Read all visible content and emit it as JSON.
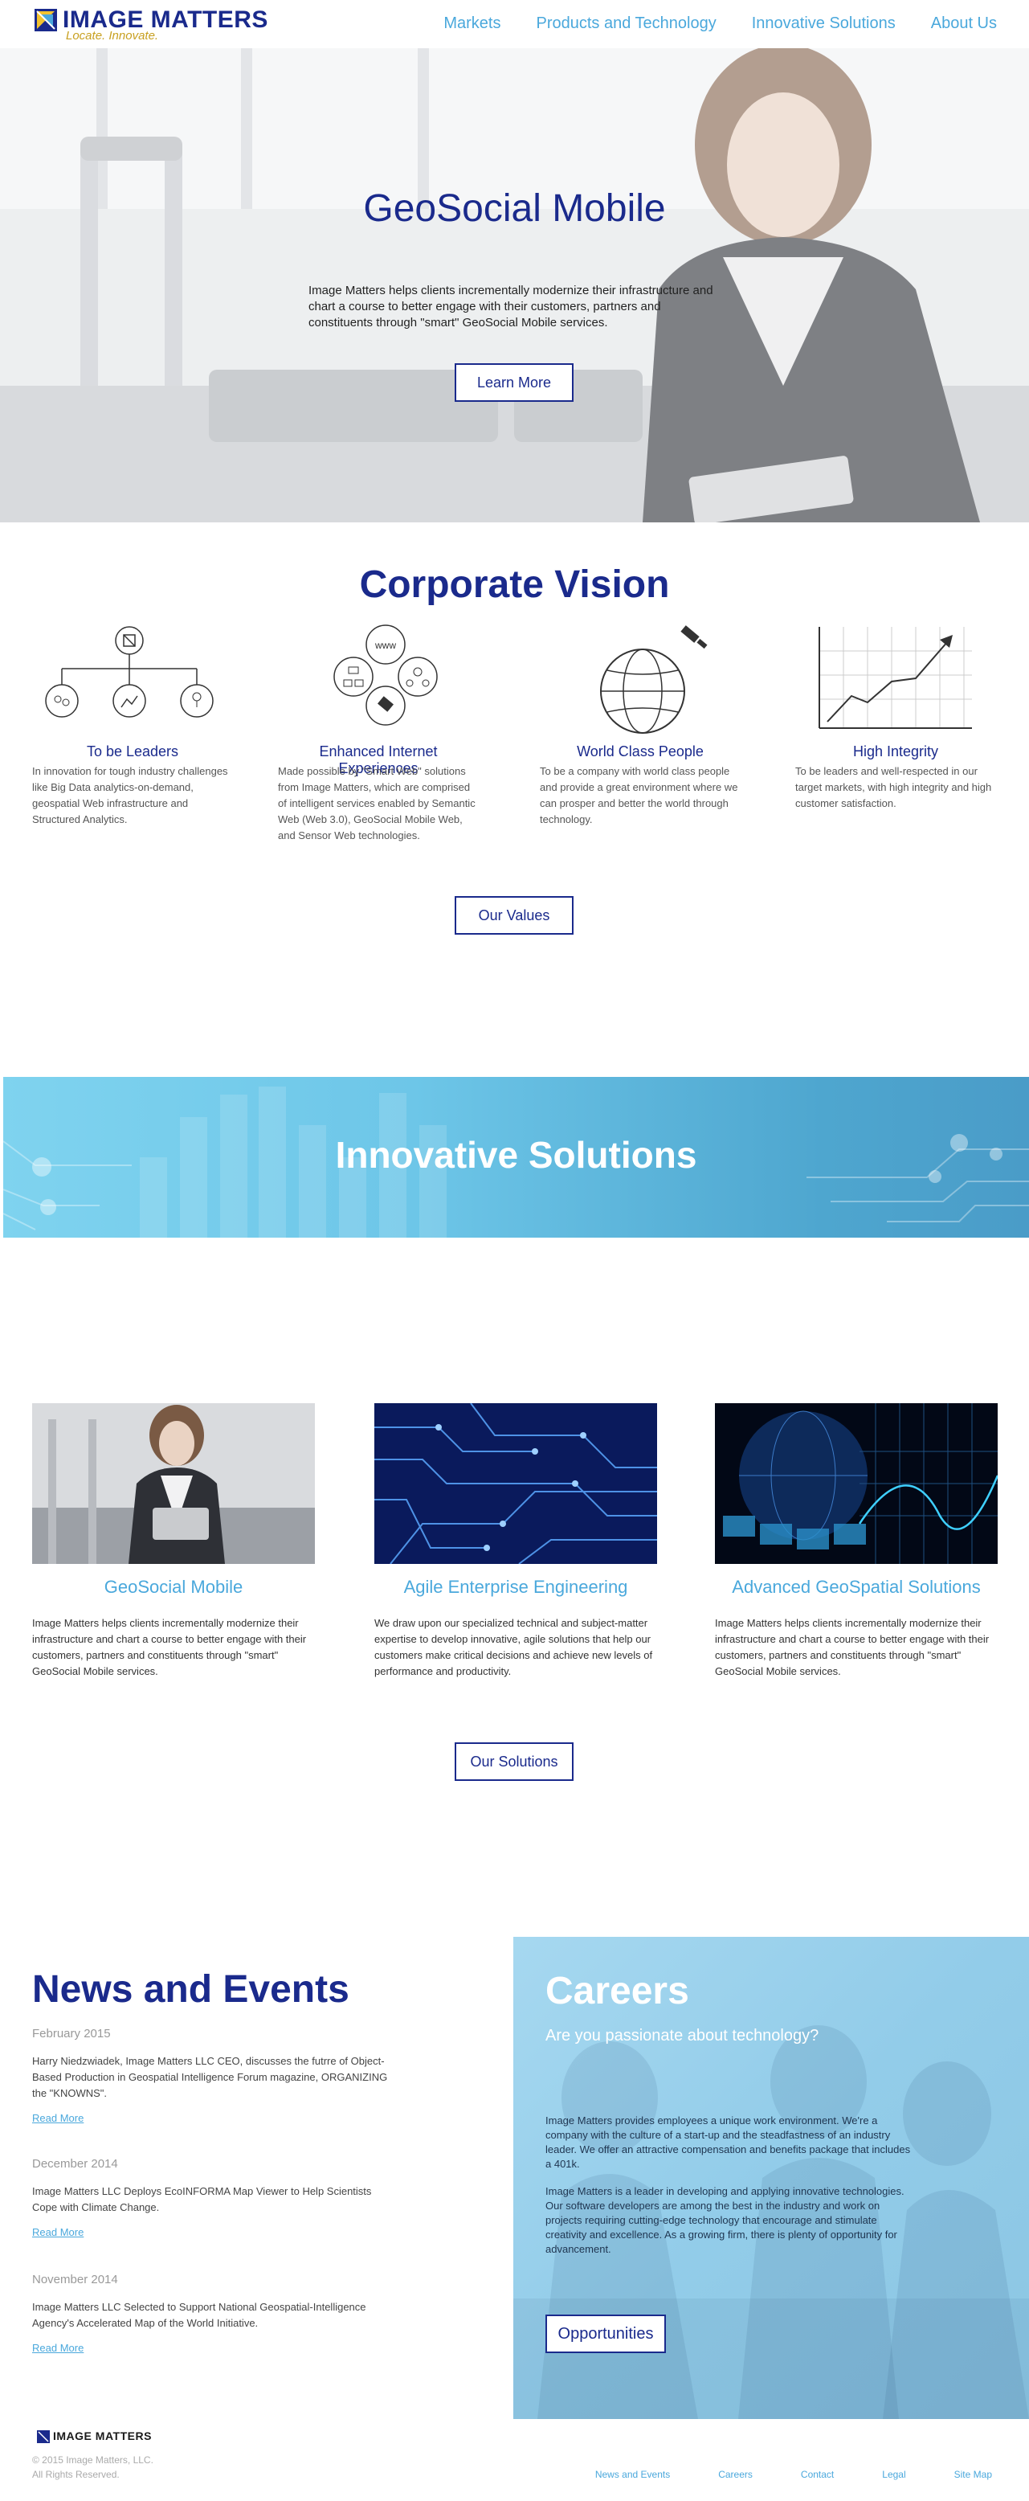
{
  "header": {
    "logo_name": "IMAGE MATTERS",
    "logo_tagline": "Locate.  Innovate.",
    "nav": [
      "Markets",
      "Products and Technology",
      "Innovative Solutions",
      "About Us"
    ]
  },
  "hero": {
    "title": "GeoSocial Mobile",
    "text": "Image Matters helps clients incrementally modernize their infrastructure and chart a course to better engage with their customers, partners and constituents through \"smart\" GeoSocial Mobile services.",
    "button": "Learn More"
  },
  "vision": {
    "title": "Corporate Vision",
    "items": [
      {
        "heading": "To be Leaders",
        "text": "In innovation for tough industry challenges like Big Data analytics-on-demand, geospatial Web infrastructure and Structured Analytics.",
        "icon": "hierarchy-icon"
      },
      {
        "heading": "Enhanced Internet Experiences",
        "text": "Made possible by \"Smart Web\" solutions from Image Matters, which are comprised of intelligent services enabled by Semantic Web (Web 3.0), GeoSocial Mobile Web, and Sensor Web technologies.",
        "icon": "web-network-icon",
        "icon_label": "www"
      },
      {
        "heading": "World Class People",
        "text": "To be a company with world class people and provide a great environment where we can prosper and better the world through technology.",
        "icon": "globe-satellite-icon"
      },
      {
        "heading": "High Integrity",
        "text": "To be leaders and well-respected in our target markets, with high integrity and high customer satisfaction.",
        "icon": "rising-chart-icon"
      }
    ],
    "button": "Our Values"
  },
  "band": {
    "title": "Innovative Solutions"
  },
  "solutions": {
    "items": [
      {
        "title": "GeoSocial Mobile",
        "text": "Image Matters helps clients incrementally modernize their infrastructure and chart a course to better engage with their customers, partners and constituents through \"smart\" GeoSocial Mobile services."
      },
      {
        "title": "Agile Enterprise Engineering",
        "text": "We draw upon our specialized technical and subject-matter expertise to develop innovative, agile solutions that help our customers make critical decisions and achieve new levels of performance and productivity."
      },
      {
        "title": "Advanced GeoSpatial Solutions",
        "text": "Image Matters helps clients incrementally modernize their infrastructure and chart a course to better engage with their customers, partners and constituents through \"smart\" GeoSocial Mobile services."
      }
    ],
    "button": "Our Solutions"
  },
  "news": {
    "title": "News and Events",
    "items": [
      {
        "date": "February 2015",
        "body": "Harry Niedzwiadek, Image Matters LLC CEO, discusses the futrre of Object-Based Production in Geospatial Intelligence Forum magazine, ORGANIZING the \"KNOWNS\".",
        "link": "Read More"
      },
      {
        "date": "December 2014",
        "body": "Image Matters LLC Deploys EcoINFORMA Map Viewer to Help Scientists Cope with Climate Change.",
        "link": "Read More"
      },
      {
        "date": "November 2014",
        "body": "Image Matters LLC Selected to Support National Geospatial-Intelligence Agency's Accelerated Map of the World Initiative.",
        "link": "Read More"
      }
    ]
  },
  "careers": {
    "title": "Careers",
    "subtitle": "Are you passionate about technology?",
    "p1": "Image Matters provides employees a unique work environment. We're a company with the culture of a start-up and the steadfastness of an industry leader. We offer an attractive compensation and benefits package that includes a 401k.",
    "p2": "Image Matters is a leader in developing and applying innovative technologies. Our software developers are among the best in the industry and work on projects requiring cutting-edge technology that encourage and stimulate creativity and excellence. As a growing firm, there is plenty of opportunity for advancement.",
    "button": "Opportunities"
  },
  "footer": {
    "logo_name": "IMAGE MATTERS",
    "copyright": "© 2015 Image Matters, LLC.",
    "rights": "All Rights Reserved.",
    "links": [
      "News and Events",
      "Careers",
      "Contact",
      "Legal",
      "Site Map"
    ]
  },
  "colors": {
    "brand_blue": "#1a2a8c",
    "accent_light_blue": "#4aa8dc",
    "tagline_gold": "#c8a020"
  }
}
